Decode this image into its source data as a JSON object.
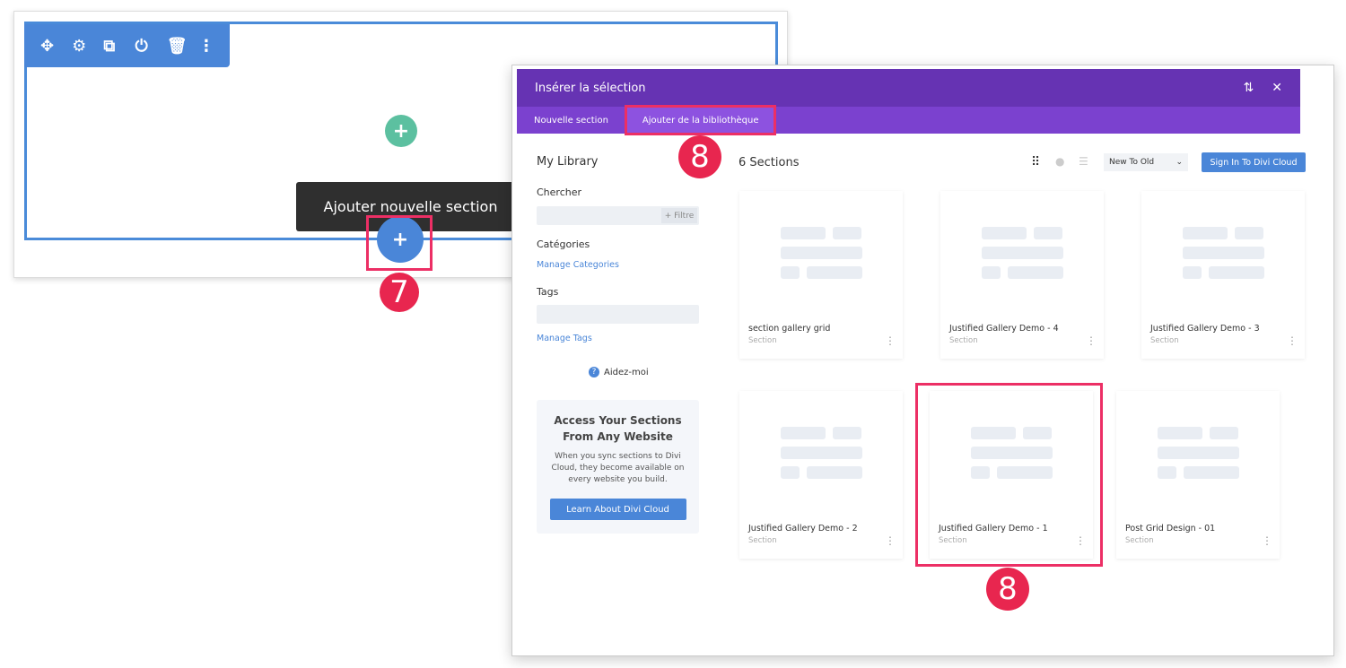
{
  "builder": {
    "toolbar_icons": [
      "move-icon",
      "gear-icon",
      "duplicate-icon",
      "save-icon",
      "trash-icon",
      "more-vertical-icon"
    ],
    "add_row_symbol": "+",
    "add_section_symbol": "+",
    "tooltip": "Ajouter nouvelle section",
    "step_badge": "7"
  },
  "modal": {
    "title": "Insérer la sélection",
    "header_icons": [
      "sort-icon",
      "close-icon"
    ],
    "tabs": [
      {
        "label": "Nouvelle section",
        "active": false
      },
      {
        "label": "Ajouter de la bibliothèque",
        "active": true
      }
    ],
    "step_badge_tab": "8",
    "step_badge_card": "8",
    "sidebar": {
      "heading": "My Library",
      "search_label": "Chercher",
      "filter_button": "+ Filtre",
      "categories_label": "Catégories",
      "manage_categories": "Manage Categories",
      "tags_label": "Tags",
      "manage_tags": "Manage Tags",
      "help": "Aidez-moi",
      "promo": {
        "title": "Access Your Sections From Any Website",
        "text": "When you sync sections to Divi Cloud, they become available on every website you build.",
        "button": "Learn About Divi Cloud"
      }
    },
    "main": {
      "count": "6 Sections",
      "sort": "New To Old",
      "signin": "Sign In To Divi Cloud",
      "cards": [
        {
          "title": "section gallery grid",
          "type": "Section"
        },
        {
          "title": "Justified Gallery Demo - 4",
          "type": "Section"
        },
        {
          "title": "Justified Gallery Demo - 3",
          "type": "Section"
        },
        {
          "title": "Justified Gallery Demo - 2",
          "type": "Section"
        },
        {
          "title": "Justified Gallery Demo - 1",
          "type": "Section",
          "highlighted": true
        },
        {
          "title": "Post Grid Design - 01",
          "type": "Section"
        }
      ]
    }
  },
  "colors": {
    "purple_header": "#6633b3",
    "purple_tabs": "#7b41cf",
    "blue": "#4a86d8",
    "green": "#5cc0a0",
    "highlight": "#ec2f65"
  }
}
